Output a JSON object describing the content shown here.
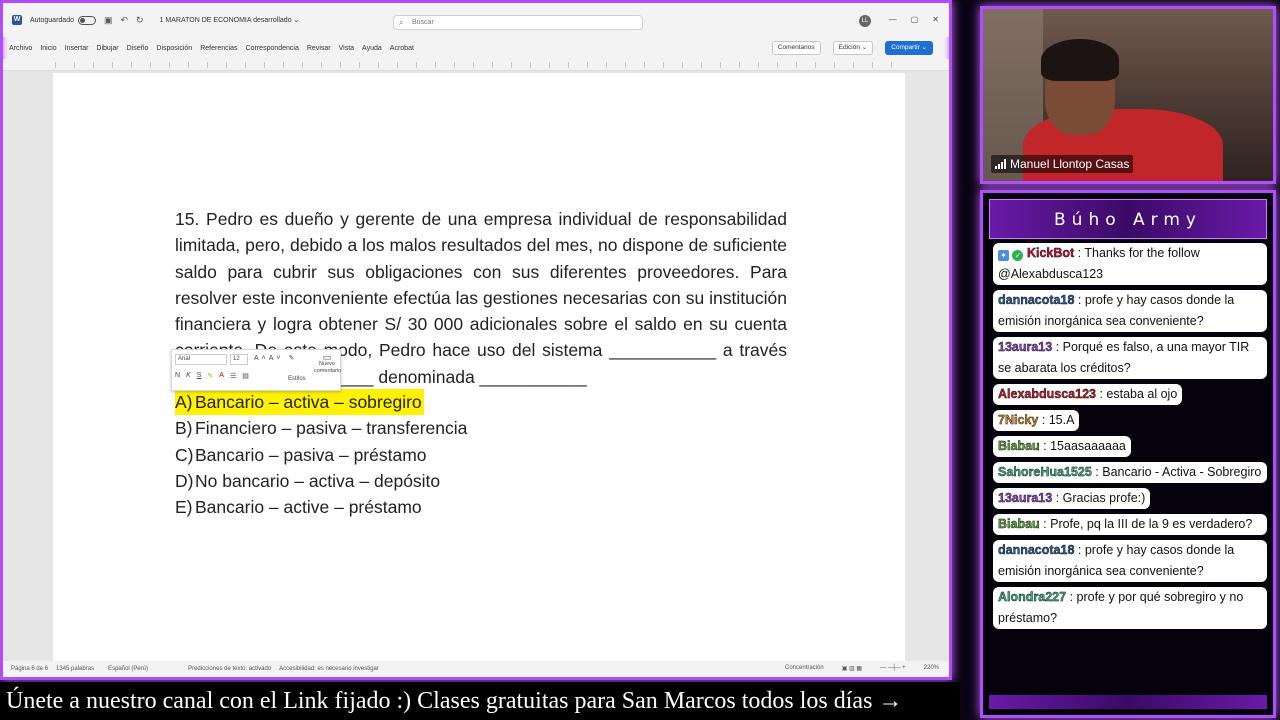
{
  "word": {
    "autosave_label": "Autoguardado",
    "doc_title": "1 MARATON DE ECONOMIA desarrollado ⌄",
    "search_placeholder": "Buscar",
    "avatar_initials": "LL",
    "menu": [
      "Archivo",
      "Inicio",
      "Insertar",
      "Dibujar",
      "Diseño",
      "Disposición",
      "Referencias",
      "Correspondencia",
      "Revisar",
      "Vista",
      "Ayuda",
      "Acrobat"
    ],
    "comments_label": "Comentarios",
    "edit_label": "Edición ⌄",
    "share_label": "Compartir ⌄",
    "question_text": "15. Pedro es dueño y gerente de una empresa individual de responsabilidad limitada, pero, debido a los malos resultados del mes, no dispone de suficiente saldo para cubrir sus obligaciones con sus diferentes proveedores. Para resolver este inconveniente efectúa las gestiones necesarias con su institución financiera y logra obtener S/ 30 000 adicionales sobre el saldo en su cuenta corriente. De este modo, Pedro hace uso del sistema ___________ a través de una operación ______ denominada ___________",
    "options": [
      {
        "letter": "A)",
        "text": "Bancario – activa – sobregiro",
        "highlight": true
      },
      {
        "letter": "B)",
        "text": "Financiero – pasiva – transferencia"
      },
      {
        "letter": "C)",
        "text": "Bancario – pasiva – préstamo"
      },
      {
        "letter": "D)",
        "text": "No bancario – activa – depósito"
      },
      {
        "letter": "E)",
        "text": "Bancario – active – préstamo"
      }
    ],
    "mini_toolbar": {
      "font": "Arial",
      "size": "12",
      "styles_label": "Estilos",
      "comment_label": "Nuevo comentario"
    },
    "status": {
      "page": "Página 6 de 6",
      "words": "1345 palabras",
      "language": "Español (Perú)",
      "predictions": "Predicciones de texto: activado",
      "accessibility": "Accesibilidad: es necesario investigar",
      "focus": "Concentración",
      "zoom": "220%"
    }
  },
  "banner_text": "Únete a nuestro canal con el Link fijado :)  Clases gratuitas para San Marcos todos los días  →",
  "webcam": {
    "name": "Manuel Llontop Casas"
  },
  "chat": {
    "title": "Búho Army",
    "messages": [
      {
        "user": "KickBot",
        "color": "#d0103a",
        "text": ": Thanks for the follow @Alexabdusca123",
        "bot": true,
        "full": true
      },
      {
        "user": "dannacota18",
        "color": "#2a5d9e",
        "text": ": profe y hay casos donde la emisión inorgánica sea conveniente?",
        "full": true
      },
      {
        "user": "13aura13",
        "color": "#8e44c7",
        "text": ": Porqué es falso, a una mayor TIR se abarata los créditos?",
        "full": true
      },
      {
        "user": "Alexabdusca123",
        "color": "#c0202a",
        "text": ": estaba al ojo"
      },
      {
        "user": "7Nicky",
        "color": "#d4892a",
        "text": ": 15.A"
      },
      {
        "user": "Biabau",
        "color": "#5aa83a",
        "text": ": 15aasaaaaaa"
      },
      {
        "user": "SahoreHua1525",
        "color": "#3fae8a",
        "text": ": Bancario - Activa - Sobregiro",
        "full": true
      },
      {
        "user": "13aura13",
        "color": "#8e44c7",
        "text": ": Gracias profe:)"
      },
      {
        "user": "Biabau",
        "color": "#5aa83a",
        "text": ": Profe, pq la III de la 9 es verdadero?",
        "full": true
      },
      {
        "user": "dannacota18",
        "color": "#2a5d9e",
        "text": ": profe y hay casos donde la emisión inorgánica sea conveniente?",
        "full": true
      },
      {
        "user": "Alondra227",
        "color": "#3fae8a",
        "text": ": profe y por qué sobregiro y no préstamo?",
        "full": true
      }
    ]
  }
}
